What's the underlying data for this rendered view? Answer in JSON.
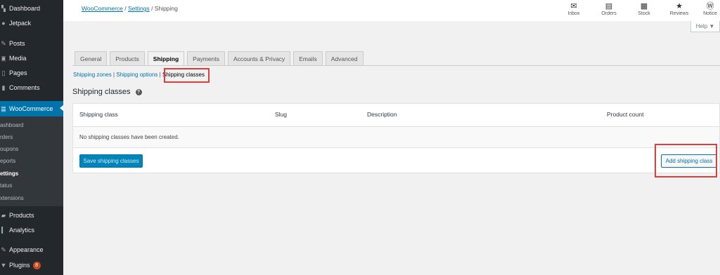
{
  "sidebar": {
    "items": [
      {
        "label": "Dashboard",
        "icon": "dashboard-icon",
        "glyph": "▚"
      },
      {
        "label": "Jetpack",
        "icon": "jetpack-icon",
        "glyph": "●"
      },
      {
        "label": "Posts",
        "icon": "posts-icon",
        "glyph": "✎"
      },
      {
        "label": "Media",
        "icon": "media-icon",
        "glyph": "▣"
      },
      {
        "label": "Pages",
        "icon": "pages-icon",
        "glyph": "▯"
      },
      {
        "label": "Comments",
        "icon": "comments-icon",
        "glyph": "▮"
      },
      {
        "label": "WooCommerce",
        "icon": "woocommerce-icon",
        "glyph": "▤"
      },
      {
        "label": "Products",
        "icon": "products-icon",
        "glyph": "▰"
      },
      {
        "label": "Analytics",
        "icon": "analytics-icon",
        "glyph": "▍"
      },
      {
        "label": "Appearance",
        "icon": "appearance-icon",
        "glyph": "✎"
      },
      {
        "label": "Plugins",
        "icon": "plugins-icon",
        "glyph": "▼",
        "badge": "8"
      }
    ],
    "submenu": [
      "ashboard",
      "rders",
      "oupons",
      "eports",
      "ettings",
      "tatus",
      "xtensions"
    ]
  },
  "breadcrumb": {
    "woocommerce": "WooCommerce",
    "sep1": " / ",
    "settings": "Settings",
    "sep2": " / ",
    "current": "Shipping"
  },
  "activity": [
    {
      "label": "Inbox",
      "icon": "inbox-icon",
      "glyph": "✉"
    },
    {
      "label": "Orders",
      "icon": "orders-icon",
      "glyph": "▤"
    },
    {
      "label": "Stock",
      "icon": "stock-icon",
      "glyph": "▦"
    },
    {
      "label": "Reviews",
      "icon": "reviews-icon",
      "glyph": "★"
    },
    {
      "label": "Notice",
      "icon": "notices-icon",
      "glyph": "Ⓦ"
    }
  ],
  "help": {
    "label": "Help ▼"
  },
  "tabs": [
    "General",
    "Products",
    "Shipping",
    "Payments",
    "Accounts & Privacy",
    "Emails",
    "Advanced"
  ],
  "subnav": {
    "zones": "Shipping zones",
    "sep1": " | ",
    "options": "Shipping options",
    "sep2": " | ",
    "classes": "Shipping classes"
  },
  "page": {
    "heading": "Shipping classes",
    "help_glyph": "?"
  },
  "table": {
    "columns": [
      "Shipping class",
      "Slug",
      "Description",
      "Product count"
    ],
    "empty_message": "No shipping classes have been created.",
    "save_label": "Save shipping classes",
    "add_label": "Add shipping class"
  },
  "colors": {
    "accent": "#0073aa",
    "sidebar": "#23282d",
    "highlight": "#e03c3c"
  }
}
